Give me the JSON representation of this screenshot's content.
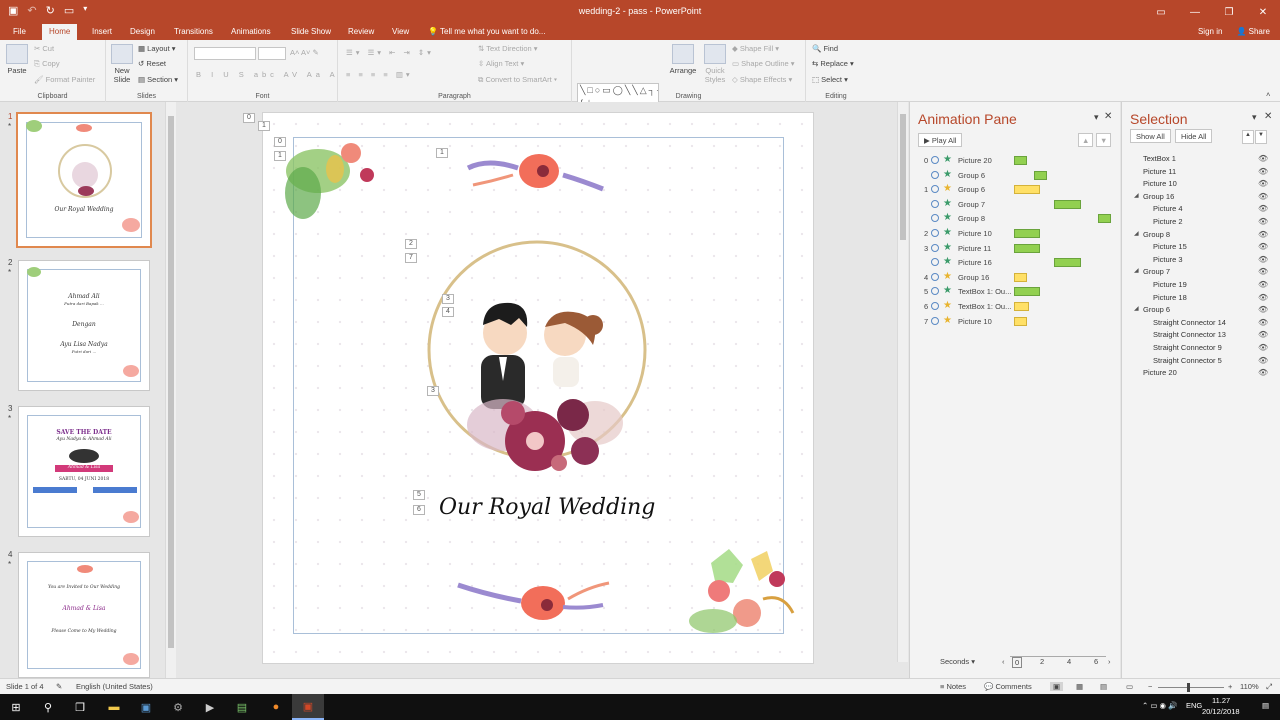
{
  "window": {
    "title": "wedding-2 - pass - PowerPoint"
  },
  "titlebar": {
    "buttons": [
      "restore-ribbon-icon",
      "minimize-icon",
      "maximize-icon",
      "close-icon"
    ]
  },
  "tabs": [
    "File",
    "Home",
    "Insert",
    "Design",
    "Transitions",
    "Animations",
    "Slide Show",
    "Review",
    "View"
  ],
  "active_tab": "Home",
  "tell_me": "Tell me what you want to do...",
  "account": {
    "signin": "Sign in",
    "share": "Share"
  },
  "ribbon": {
    "clipboard": {
      "paste": "Paste",
      "cut": "Cut",
      "copy": "Copy",
      "format_painter": "Format Painter",
      "label": "Clipboard"
    },
    "slides": {
      "new_slide": "New Slide",
      "layout": "Layout",
      "reset": "Reset",
      "section": "Section",
      "label": "Slides"
    },
    "font": {
      "label": "Font",
      "buttons": "B I U S abc AV Aa A"
    },
    "paragraph": {
      "text_direction": "Text Direction",
      "align_text": "Align Text",
      "smartart": "Convert to SmartArt",
      "label": "Paragraph"
    },
    "drawing": {
      "arrange": "Arrange",
      "quick_styles": "Quick Styles",
      "shape_fill": "Shape Fill",
      "shape_outline": "Shape Outline",
      "shape_effects": "Shape Effects",
      "label": "Drawing",
      "shape_glyphs": "╲□○▭◯╲╲△┐┐⇨⇩⇦△╭╮╯(){☆"
    },
    "editing": {
      "find": "Find",
      "replace": "Replace",
      "select": "Select",
      "label": "Editing"
    }
  },
  "thumbnails": [
    {
      "num": "1",
      "lines": [
        "Our Royal Wedding"
      ]
    },
    {
      "num": "2",
      "lines": [
        "Ahmad Ali",
        "Putra dari Bapak ...",
        "Dengan",
        "Ayu Lisa Nadya",
        "Putri dari ..."
      ]
    },
    {
      "num": "3",
      "lines": [
        "SAVE THE DATE",
        "Ayu Nadya & Ahmad Ali",
        "Ahmad & Lisa",
        "SABTU, 04 JUNI 2018"
      ]
    },
    {
      "num": "4",
      "lines": [
        "You are Invited to Our Wedding",
        "Ahmad & Lisa",
        "Please Come to My Wedding"
      ]
    }
  ],
  "slide": {
    "title_text": "Our Royal Wedding",
    "tags": [
      "0",
      "1",
      "0",
      "1",
      "1",
      "2",
      "7",
      "3",
      "4",
      "3",
      "5",
      "6"
    ]
  },
  "animation_pane": {
    "title": "Animation Pane",
    "play_all": "Play All",
    "rows": [
      {
        "num": "0",
        "name": "Picture 20",
        "star": "green",
        "bar": "green",
        "bar_start": 0.0,
        "bar_len": 0.06
      },
      {
        "num": "",
        "name": "Group 6",
        "star": "green",
        "bar": "green",
        "bar_start": 0.06,
        "bar_len": 0.06
      },
      {
        "num": "1",
        "name": "Group 6",
        "star": "yellow",
        "bar": "yellow",
        "bar_start": 0.0,
        "bar_len": 0.12
      },
      {
        "num": "",
        "name": "Group 7",
        "star": "green",
        "bar": "green",
        "bar_start": 0.12,
        "bar_len": 0.12
      },
      {
        "num": "",
        "name": "Group 8",
        "star": "green",
        "bar": "green",
        "bar_start": 0.25,
        "bar_len": 0.06
      },
      {
        "num": "2",
        "name": "Picture 10",
        "star": "green",
        "bar": "green",
        "bar_start": 0.0,
        "bar_len": 0.12
      },
      {
        "num": "3",
        "name": "Picture 11",
        "star": "green",
        "bar": "green",
        "bar_start": 0.0,
        "bar_len": 0.12
      },
      {
        "num": "",
        "name": "Picture 16",
        "star": "green",
        "bar": "green",
        "bar_start": 0.12,
        "bar_len": 0.12
      },
      {
        "num": "4",
        "name": "Group 16",
        "star": "yellow",
        "bar": "yellow",
        "bar_start": 0.0,
        "bar_len": 0.06
      },
      {
        "num": "5",
        "name": "TextBox 1: Ou...",
        "star": "green",
        "bar": "green",
        "bar_start": 0.0,
        "bar_len": 0.12
      },
      {
        "num": "6",
        "name": "TextBox 1: Ou...",
        "star": "yellow",
        "bar": "yellow",
        "bar_start": 0.0,
        "bar_len": 0.07
      },
      {
        "num": "7",
        "name": "Picture 10",
        "star": "yellow",
        "bar": "yellow",
        "bar_start": 0.0,
        "bar_len": 0.06
      }
    ],
    "seconds_label": "Seconds",
    "timeline": [
      "0",
      "2",
      "4",
      "6"
    ]
  },
  "selection_pane": {
    "title": "Selection",
    "show_all": "Show All",
    "hide_all": "Hide All",
    "items": [
      {
        "name": "TextBox 1",
        "level": 0,
        "group": false
      },
      {
        "name": "Picture 11",
        "level": 0,
        "group": false
      },
      {
        "name": "Picture 10",
        "level": 0,
        "group": false
      },
      {
        "name": "Group 16",
        "level": 0,
        "group": true
      },
      {
        "name": "Picture 4",
        "level": 1,
        "group": false
      },
      {
        "name": "Picture 2",
        "level": 1,
        "group": false
      },
      {
        "name": "Group 8",
        "level": 0,
        "group": true
      },
      {
        "name": "Picture 15",
        "level": 1,
        "group": false
      },
      {
        "name": "Picture 3",
        "level": 1,
        "group": false
      },
      {
        "name": "Group 7",
        "level": 0,
        "group": true
      },
      {
        "name": "Picture 19",
        "level": 1,
        "group": false
      },
      {
        "name": "Picture 18",
        "level": 1,
        "group": false
      },
      {
        "name": "Group 6",
        "level": 0,
        "group": true
      },
      {
        "name": "Straight Connector 14",
        "level": 1,
        "group": false
      },
      {
        "name": "Straight Connector 13",
        "level": 1,
        "group": false
      },
      {
        "name": "Straight Connector 9",
        "level": 1,
        "group": false
      },
      {
        "name": "Straight Connector 5",
        "level": 1,
        "group": false
      },
      {
        "name": "Picture 20",
        "level": 0,
        "group": false
      }
    ]
  },
  "status": {
    "slide_of": "Slide 1 of 4",
    "language": "English (United States)",
    "notes": "Notes",
    "comments": "Comments",
    "zoom": "110%"
  },
  "taskbar": {
    "lang": "ENG",
    "time": "11.27",
    "date": "20/12/2018"
  },
  "colors": {
    "accent": "#b7472a",
    "green_bar": "#92d050",
    "yellow_bar": "#ffe066",
    "green_star": "#3b9b6a",
    "yellow_star": "#e8b430"
  }
}
